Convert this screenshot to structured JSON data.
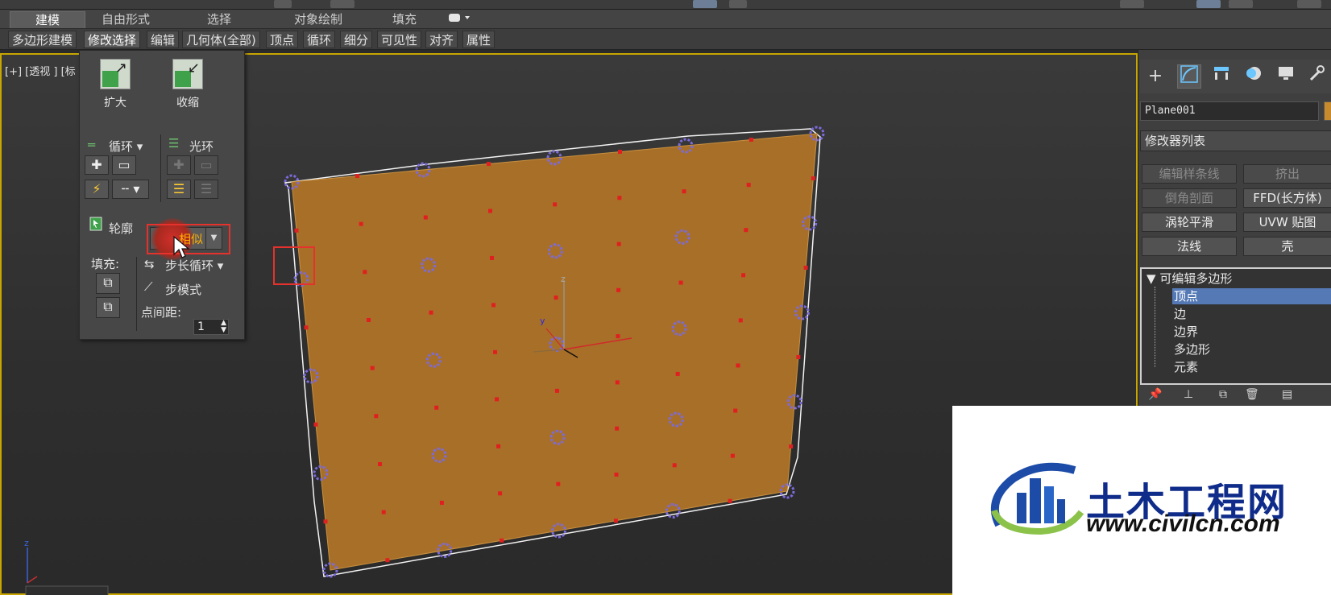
{
  "ribbon": {
    "tabs": [
      {
        "label": "建模",
        "active": true
      },
      {
        "label": "自由形式",
        "active": false
      },
      {
        "label": "选择",
        "active": false
      },
      {
        "label": "对象绘制",
        "active": false
      },
      {
        "label": "填充",
        "active": false
      }
    ]
  },
  "sub_ribbon": {
    "items": [
      {
        "label": "多边形建模",
        "active": false
      },
      {
        "label": "修改选择",
        "active": true
      },
      {
        "label": "编辑",
        "active": false
      },
      {
        "label": "几何体(全部)",
        "active": false
      },
      {
        "label": "顶点",
        "active": false
      },
      {
        "label": "循环",
        "active": false
      },
      {
        "label": "细分",
        "active": false
      },
      {
        "label": "可见性",
        "active": false
      },
      {
        "label": "对齐",
        "active": false
      },
      {
        "label": "属性",
        "active": false
      }
    ]
  },
  "viewport": {
    "label": "[+] [透视 ] [标"
  },
  "selection_panel": {
    "grow": "扩大",
    "shrink": "收缩",
    "loop": "循环",
    "ring": "光环",
    "outline": "轮廓",
    "similar": "相似",
    "fill": "填充:",
    "step_loop": "步长循环",
    "step_mode": "步模式",
    "dot_gap": "点间距:",
    "dot_gap_value": "1"
  },
  "command_panel": {
    "object_name": "Plane001",
    "object_color": "#c78a2c",
    "modifier_list": "修改器列表",
    "buttons": [
      {
        "label": "编辑样条线",
        "enabled": false
      },
      {
        "label": "挤出",
        "enabled": false
      },
      {
        "label": "倒角剖面",
        "enabled": false
      },
      {
        "label": "FFD(长方体)",
        "enabled": true
      },
      {
        "label": "涡轮平滑",
        "enabled": true
      },
      {
        "label": "UVW 贴图",
        "enabled": true
      },
      {
        "label": "法线",
        "enabled": true
      },
      {
        "label": "壳",
        "enabled": true
      }
    ],
    "stack": {
      "root": "可编辑多边形",
      "levels": [
        {
          "label": "顶点",
          "selected": true
        },
        {
          "label": "边",
          "selected": false
        },
        {
          "label": "边界",
          "selected": false
        },
        {
          "label": "多边形",
          "selected": false
        },
        {
          "label": "元素",
          "selected": false
        }
      ]
    }
  },
  "watermark": {
    "title": "土木工程网",
    "url": "www.civilcn.com"
  },
  "colors": {
    "plane": "#a86f28",
    "selection_vertex": "#7b6bdc",
    "unselected_vertex": "#e02020",
    "highlight_box": "#e5322d",
    "stack_selected": "#5479b5"
  },
  "icons": {
    "create": "plus-icon",
    "modify": "modify-curve-icon",
    "hierarchy": "hierarchy-icon",
    "motion": "motion-icon",
    "display": "display-icon",
    "utilities": "wrench-icon"
  }
}
